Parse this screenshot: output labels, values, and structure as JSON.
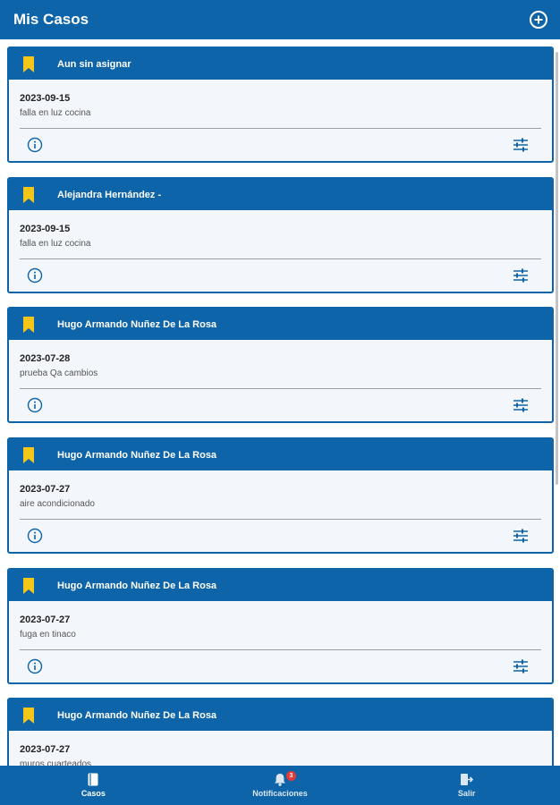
{
  "header": {
    "title": "Mis Casos",
    "add_icon": "add-circle-icon"
  },
  "cases": [
    {
      "assignee": "Aun sin asignar",
      "date": "2023-09-15",
      "description": "falla en luz cocina"
    },
    {
      "assignee": "Alejandra Hernández -",
      "date": "2023-09-15",
      "description": "falla en luz cocina"
    },
    {
      "assignee": "Hugo Armando Nuñez De La Rosa",
      "date": "2023-07-28",
      "description": "prueba Qa cambios"
    },
    {
      "assignee": "Hugo Armando Nuñez De La Rosa",
      "date": "2023-07-27",
      "description": "aire acondicionado"
    },
    {
      "assignee": "Hugo Armando Nuñez De La Rosa",
      "date": "2023-07-27",
      "description": "fuga en tinaco"
    },
    {
      "assignee": "Hugo Armando Nuñez De La Rosa",
      "date": "2023-07-27",
      "description": "muros cuarteados"
    }
  ],
  "bottom_nav": {
    "items": [
      {
        "label": "Casos",
        "icon": "book-icon",
        "active": true
      },
      {
        "label": "Notificaciones",
        "icon": "bell-icon",
        "badge": "3"
      },
      {
        "label": "Salir",
        "icon": "logout-icon"
      }
    ]
  },
  "colors": {
    "primary": "#0e64a8",
    "bookmark": "#f5c518",
    "card_bg": "#f3f6fb",
    "badge": "#e53935"
  }
}
